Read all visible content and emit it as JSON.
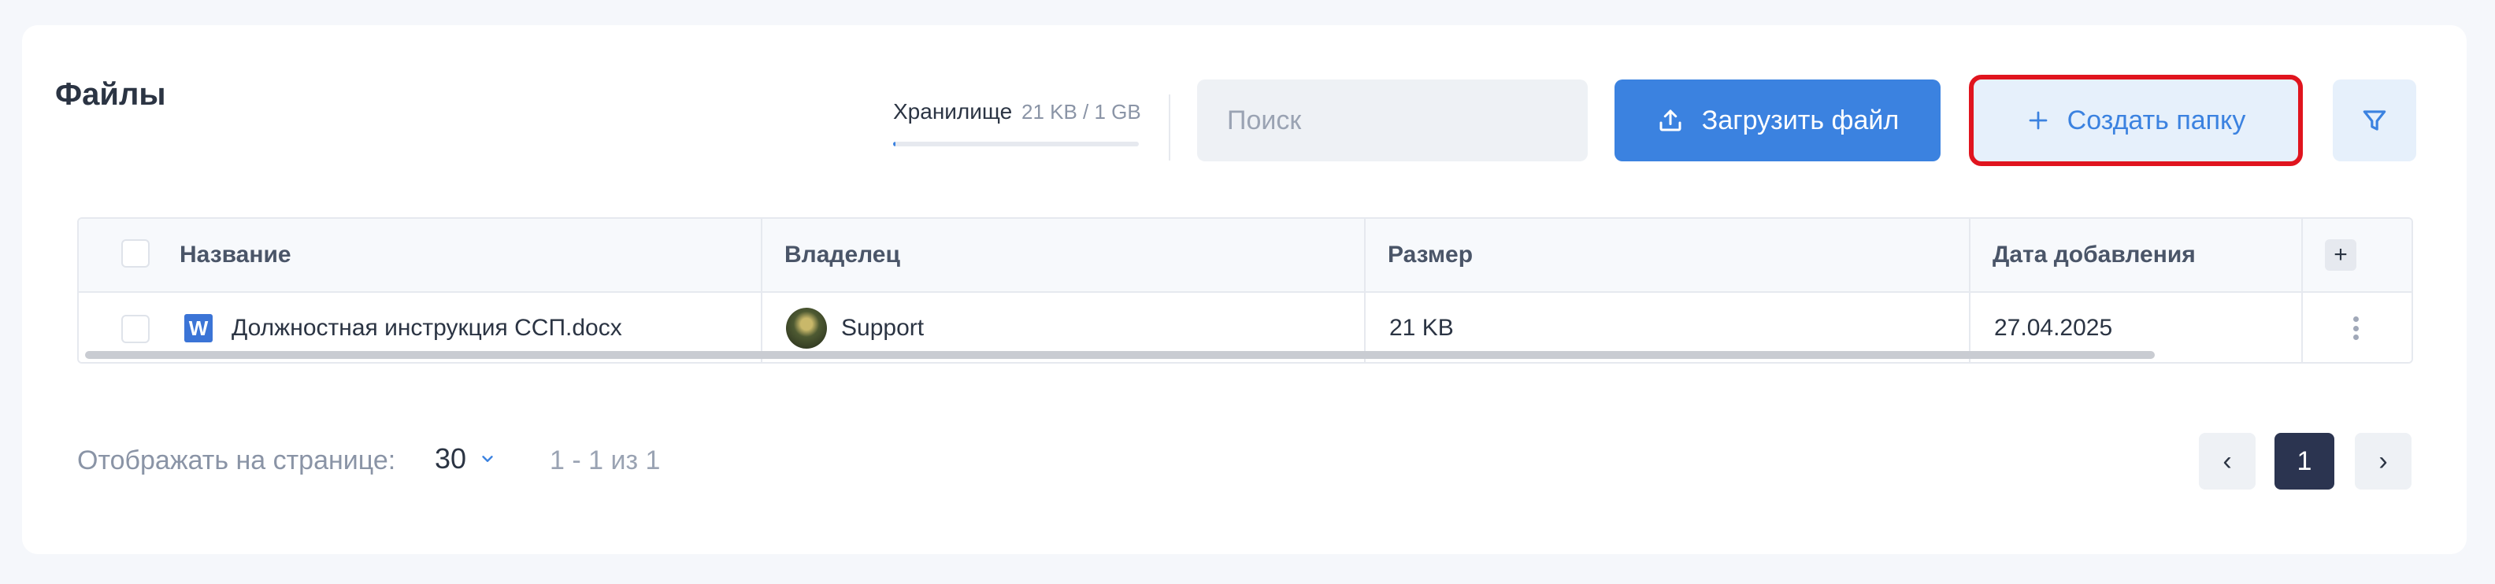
{
  "header": {
    "title": "Файлы"
  },
  "storage": {
    "label": "Хранилище",
    "value": "21 KB / 1 GB",
    "used_fraction": 0.01
  },
  "search": {
    "placeholder": "Поиск",
    "value": ""
  },
  "toolbar": {
    "upload_label": "Загрузить файл",
    "upload_icon": "upload-icon",
    "create_folder_label": "Создать папку",
    "create_folder_icon": "plus-icon",
    "filter_icon": "filter-icon",
    "accent_color": "#3b82e0",
    "highlight_color": "#e0141e"
  },
  "table": {
    "columns": [
      "Название",
      "Владелец",
      "Размер",
      "Дата добавления"
    ],
    "rows": [
      {
        "name": "Должностная инструкция ССП.docx",
        "file_icon": "W",
        "owner": "Support",
        "size": "21 KB",
        "date": "27.04.2025"
      }
    ]
  },
  "footer": {
    "per_page_label": "Отображать на странице:",
    "per_page_value": "30",
    "range": "1 - 1 из 1",
    "current_page": "1",
    "prev_icon": "‹",
    "next_icon": "›"
  }
}
